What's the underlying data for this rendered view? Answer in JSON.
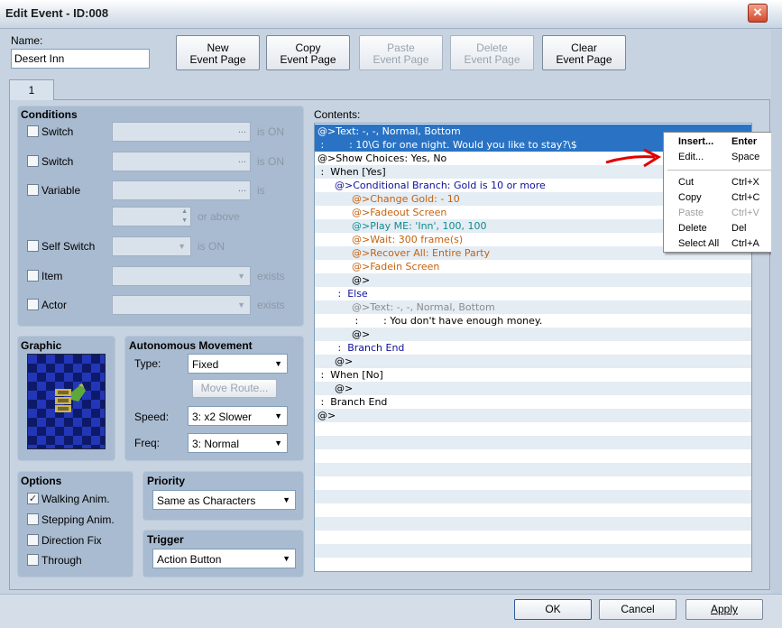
{
  "window": {
    "title": "Edit Event - ID:008",
    "close_icon": "×"
  },
  "name_field": {
    "label": "Name:",
    "value": "Desert Inn"
  },
  "toolbar": {
    "new_page": [
      "New",
      "Event Page"
    ],
    "copy_page": [
      "Copy",
      "Event Page"
    ],
    "paste_page": [
      "Paste",
      "Event Page"
    ],
    "delete_page": [
      "Delete",
      "Event Page"
    ],
    "clear_page": [
      "Clear",
      "Event Page"
    ]
  },
  "tabs": [
    "1"
  ],
  "conditions": {
    "title": "Conditions",
    "switch1": {
      "label": "Switch",
      "suffix": "is ON",
      "dots": "..."
    },
    "switch2": {
      "label": "Switch",
      "suffix": "is ON",
      "dots": "..."
    },
    "variable": {
      "label": "Variable",
      "suffix": "is",
      "dots": "...",
      "or_above": "or above"
    },
    "self_switch": {
      "label": "Self Switch",
      "suffix": "is ON"
    },
    "item": {
      "label": "Item",
      "suffix": "exists"
    },
    "actor": {
      "label": "Actor",
      "suffix": "exists"
    }
  },
  "graphic": {
    "title": "Graphic"
  },
  "movement": {
    "title": "Autonomous Movement",
    "type_label": "Type:",
    "type_value": "Fixed",
    "move_route": "Move Route...",
    "speed_label": "Speed:",
    "speed_value": "3: x2 Slower",
    "freq_label": "Freq:",
    "freq_value": "3: Normal"
  },
  "options": {
    "title": "Options",
    "walking": {
      "label": "Walking Anim.",
      "checked": true
    },
    "stepping": {
      "label": "Stepping Anim.",
      "checked": false
    },
    "direction": {
      "label": "Direction Fix",
      "checked": false
    },
    "through": {
      "label": "Through",
      "checked": false
    }
  },
  "priority": {
    "title": "Priority",
    "value": "Same as Characters"
  },
  "trigger": {
    "title": "Trigger",
    "value": "Action Button"
  },
  "contents": {
    "label": "Contents:",
    "rows": [
      {
        "indent": 0,
        "text": "@>Text: -, -, Normal, Bottom",
        "color": "white",
        "selected": true
      },
      {
        "indent": 0,
        "text": " :        : 10\\G for one night. Would you like to stay?\\$",
        "color": "white",
        "selected": true
      },
      {
        "indent": 0,
        "text": "@>Show Choices: Yes, No",
        "color": "black"
      },
      {
        "indent": 0,
        "text": " :  When [Yes]",
        "color": "black"
      },
      {
        "indent": 1,
        "text": "@>Conditional Branch: Gold is 10 or more",
        "color": "blue"
      },
      {
        "indent": 2,
        "text": "@>Change Gold: - 10",
        "color": "orange"
      },
      {
        "indent": 2,
        "text": "@>Fadeout Screen",
        "color": "orange"
      },
      {
        "indent": 2,
        "text": "@>Play ME: 'Inn', 100, 100",
        "color": "teal"
      },
      {
        "indent": 2,
        "text": "@>Wait: 300 frame(s)",
        "color": "orange"
      },
      {
        "indent": 2,
        "text": "@>Recover All: Entire Party",
        "color": "orange"
      },
      {
        "indent": 2,
        "text": "@>Fadein Screen",
        "color": "orange"
      },
      {
        "indent": 2,
        "text": "@>",
        "color": "black"
      },
      {
        "indent": 1,
        "text": " :  Else",
        "color": "blue"
      },
      {
        "indent": 2,
        "text": "@>Text: -, -, Normal, Bottom",
        "color": "gray"
      },
      {
        "indent": 2,
        "text": " :        : You don't have enough money.",
        "color": "black"
      },
      {
        "indent": 2,
        "text": "@>",
        "color": "black"
      },
      {
        "indent": 1,
        "text": " :  Branch End",
        "color": "blue"
      },
      {
        "indent": 1,
        "text": "@>",
        "color": "black"
      },
      {
        "indent": 0,
        "text": " :  When [No]",
        "color": "black"
      },
      {
        "indent": 1,
        "text": "@>",
        "color": "black"
      },
      {
        "indent": 0,
        "text": " :  Branch End",
        "color": "black"
      },
      {
        "indent": 0,
        "text": "@>",
        "color": "black"
      }
    ]
  },
  "context_menu": {
    "items": [
      {
        "label": "Insert...",
        "key": "Enter",
        "bold": true
      },
      {
        "label": "Edit...",
        "key": "Space"
      },
      {
        "separator": true
      },
      {
        "label": "Cut",
        "key": "Ctrl+X"
      },
      {
        "label": "Copy",
        "key": "Ctrl+C"
      },
      {
        "label": "Paste",
        "key": "Ctrl+V",
        "disabled": true
      },
      {
        "label": "Delete",
        "key": "Del"
      },
      {
        "label": "Select All",
        "key": "Ctrl+A"
      }
    ]
  },
  "footer": {
    "ok": "OK",
    "cancel": "Cancel",
    "apply": "Apply"
  },
  "colors": {
    "selection": "#2a73c4",
    "arrow": "#e00000",
    "panel": "#a9bbd0",
    "window_bg": "#c7d3e1"
  }
}
